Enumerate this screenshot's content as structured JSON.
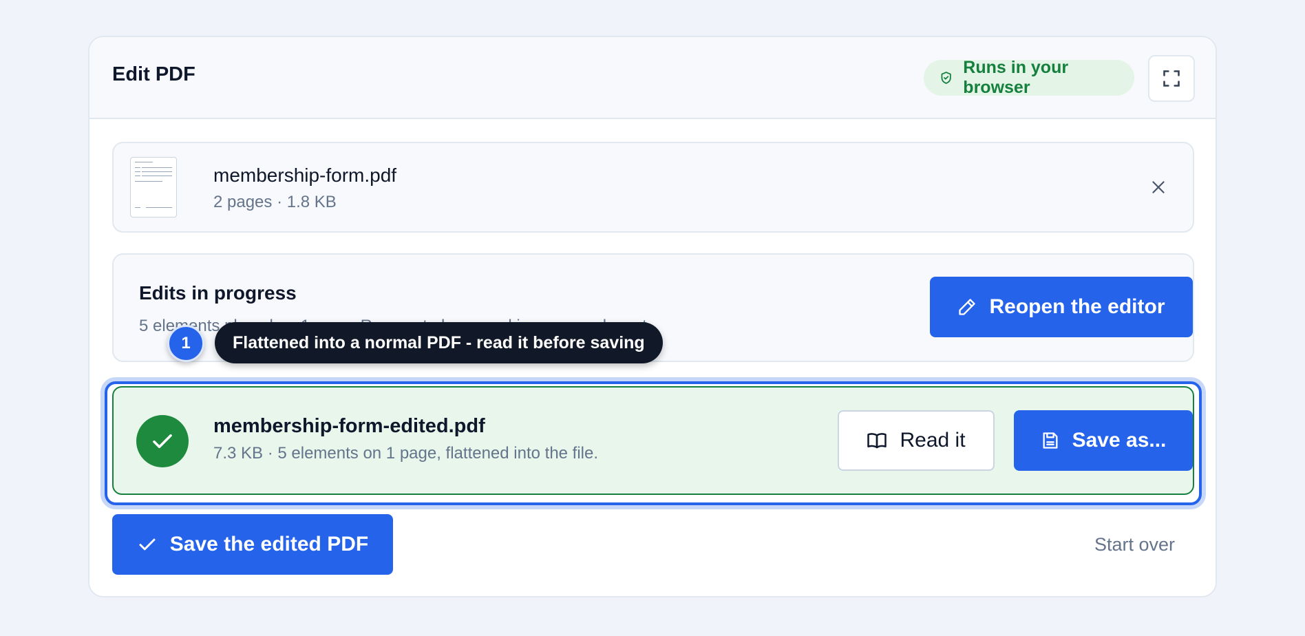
{
  "header": {
    "title": "Edit PDF",
    "badge": "Runs in your browser",
    "badge_icon": "shield-check-icon",
    "expand_icon": "fullscreen-icon"
  },
  "source_file": {
    "name": "membership-form.pdf",
    "meta": "2 pages · 1.8 KB",
    "remove_icon": "close-icon"
  },
  "edits": {
    "title": "Edits in progress",
    "description": "5 elements placed on 1 page. Reopen to keep working on your layout.",
    "reopen_label": "Reopen the editor",
    "reopen_icon": "pencil-icon"
  },
  "tooltip": {
    "step": "1",
    "text": "Flattened into a normal PDF - read it before saving"
  },
  "result": {
    "name": "membership-form-edited.pdf",
    "meta": "7.3 KB · 5 elements on 1 page, flattened into the file.",
    "read_label": "Read it",
    "save_as_label": "Save as...",
    "read_icon": "book-open-icon",
    "save_as_icon": "save-file-icon"
  },
  "footer": {
    "save_label": "Save the edited PDF",
    "start_over_label": "Start over"
  },
  "colors": {
    "accent": "#2563eb",
    "success": "#15803d",
    "success_bg": "#e8f6ec"
  }
}
